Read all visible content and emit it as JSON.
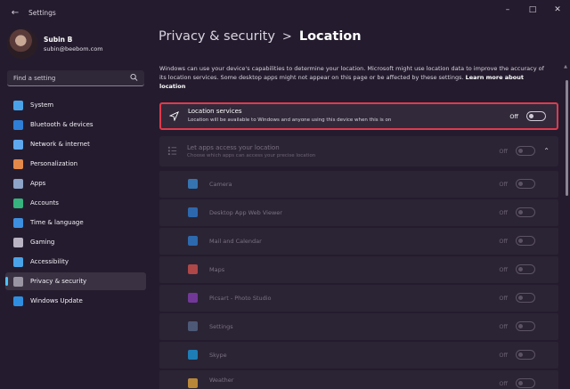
{
  "window": {
    "title": "Settings",
    "back_icon": "back-arrow-icon",
    "controls": [
      "minimize-icon",
      "maximize-icon",
      "close-icon"
    ]
  },
  "profile": {
    "name": "Subin B",
    "email": "subin@beebom.com"
  },
  "search": {
    "placeholder": "Find a setting"
  },
  "sidebar": {
    "items": [
      {
        "label": "System",
        "icon": "system-icon",
        "color": "#4aa3e8",
        "active": false
      },
      {
        "label": "Bluetooth & devices",
        "icon": "bluetooth-icon",
        "color": "#2f7fd6",
        "active": false
      },
      {
        "label": "Network & internet",
        "icon": "wifi-icon",
        "color": "#5fa8ee",
        "active": false
      },
      {
        "label": "Personalization",
        "icon": "brush-icon",
        "color": "#e38a4b",
        "active": false
      },
      {
        "label": "Apps",
        "icon": "apps-icon",
        "color": "#8ea4c8",
        "active": false
      },
      {
        "label": "Accounts",
        "icon": "person-icon",
        "color": "#36b37e",
        "active": false
      },
      {
        "label": "Time & language",
        "icon": "globe-clock-icon",
        "color": "#3d8fe0",
        "active": false
      },
      {
        "label": "Gaming",
        "icon": "controller-icon",
        "color": "#b9b3c4",
        "active": false
      },
      {
        "label": "Accessibility",
        "icon": "accessibility-icon",
        "color": "#4aa3e8",
        "active": false
      },
      {
        "label": "Privacy & security",
        "icon": "shield-icon",
        "color": "#9a95a2",
        "active": true
      },
      {
        "label": "Windows Update",
        "icon": "update-icon",
        "color": "#2f8ee0",
        "active": false
      }
    ]
  },
  "breadcrumb": {
    "parent": "Privacy & security",
    "separator": ">",
    "current": "Location"
  },
  "description": {
    "text": "Windows can use your device's capabilities to determine your location. Microsoft might use location data to improve the accuracy of its location services. Some desktop apps might not appear on this page or be affected by these settings. ",
    "link": "Learn more about location"
  },
  "location_services": {
    "title": "Location services",
    "subtitle": "Location will be available to Windows and anyone using this device when this is on",
    "toggle_label": "Off",
    "icon": "location-arrow-icon",
    "highlight_color": "#e03a4c"
  },
  "apps_access": {
    "title": "Let apps access your location",
    "subtitle": "Choose which apps can access your precise location",
    "toggle_label": "Off",
    "icon": "list-icon",
    "expand_icon": "chevron-up-icon"
  },
  "apps": [
    {
      "name": "Camera",
      "icon": "camera-icon",
      "color": "#3a8fd9",
      "toggle_label": "Off"
    },
    {
      "name": "Desktop App Web Viewer",
      "icon": "webview-icon",
      "color": "#2f7fd6",
      "toggle_label": "Off"
    },
    {
      "name": "Mail and Calendar",
      "icon": "mail-icon",
      "color": "#2f80d6",
      "toggle_label": "Off"
    },
    {
      "name": "Maps",
      "icon": "maps-icon",
      "color": "#d9534f",
      "toggle_label": "Off"
    },
    {
      "name": "Picsart - Photo Studio",
      "icon": "picsart-icon",
      "color": "#8a3fb8",
      "toggle_label": "Off"
    },
    {
      "name": "Settings",
      "icon": "settings-gear-icon",
      "color": "#5a6b8c",
      "toggle_label": "Off"
    },
    {
      "name": "Skype",
      "icon": "skype-icon",
      "color": "#1b9be0",
      "toggle_label": "Off"
    },
    {
      "name": "Weather",
      "icon": "weather-icon",
      "color": "#e8a83a",
      "toggle_label": "Off"
    }
  ],
  "colors": {
    "accent": "#4cc2ff",
    "background": "#241c2e",
    "card": "#2e2737"
  }
}
